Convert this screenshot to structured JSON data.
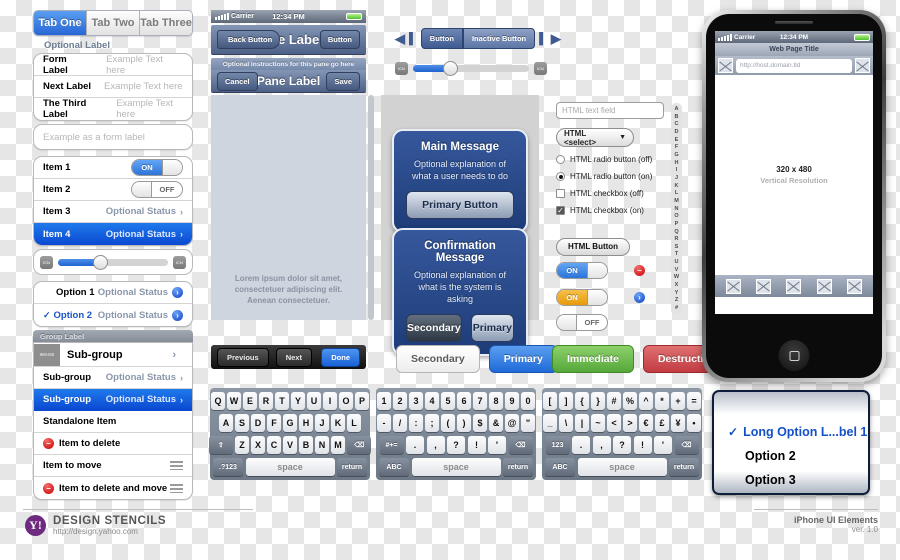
{
  "tabs": [
    {
      "label": "Tab One",
      "active": true
    },
    {
      "label": "Tab Two",
      "active": false
    },
    {
      "label": "Tab Three",
      "active": false
    }
  ],
  "form": {
    "optional_label": "Optional Label",
    "rows": [
      {
        "label": "Form Label",
        "placeholder": "Example Text here"
      },
      {
        "label": "Next Label",
        "placeholder": "Example Text here"
      },
      {
        "label": "The Third Label",
        "placeholder": "Example Text here"
      }
    ],
    "standalone_placeholder": "Example as a form label"
  },
  "items": [
    {
      "label": "Item 1",
      "toggle": "ON"
    },
    {
      "label": "Item 2",
      "toggle": "OFF"
    },
    {
      "label": "Item 3",
      "status": "Optional Status"
    },
    {
      "label": "Item 4",
      "status": "Optional Status",
      "selected": true
    }
  ],
  "options": [
    {
      "label": "Option 1",
      "status": "Optional Status",
      "checked": false
    },
    {
      "label": "Option 2",
      "status": "Optional Status",
      "checked": true
    }
  ],
  "group": {
    "label": "Group Label",
    "image_tag": "IMAGE",
    "rows": [
      {
        "label": "Sub-group",
        "status": "",
        "image": true
      },
      {
        "label": "Sub-group",
        "status": "Optional Status"
      },
      {
        "label": "Sub-group",
        "status": "Optional Status",
        "selected": true
      },
      {
        "label": "Standalone Item"
      },
      {
        "label": "Item to delete",
        "delete": true
      },
      {
        "label": "Item to move",
        "move": true
      },
      {
        "label": "Item to delete and move",
        "delete": true,
        "move": true
      }
    ]
  },
  "status_bar": {
    "carrier": "Carrier",
    "time": "12:34 PM"
  },
  "navbar1": {
    "back": "Back Button",
    "title": "Pane Label",
    "right": "Button"
  },
  "navbar2": {
    "instructions": "Optional instructions for this pane go here",
    "cancel": "Cancel",
    "title": "Pane Label",
    "save": "Save"
  },
  "pane": {
    "lorem": "Lorem ipsum dolor sit amet, consectetuer adipiscing elit. Aenean consectetuer."
  },
  "toolbar": {
    "previous": "Previous",
    "next": "Next",
    "done": "Done"
  },
  "segmented": {
    "button": "Button",
    "inactive": "Inactive Button"
  },
  "alerts": [
    {
      "title": "Main Message",
      "body": "Optional explanation of what a user needs to do",
      "buttons": [
        {
          "label": "Primary Button",
          "style": "primary"
        }
      ]
    },
    {
      "title": "Confirmation Message",
      "body": "Optional explanation of what is the system is asking",
      "buttons": [
        {
          "label": "Secondary",
          "style": "secondary"
        },
        {
          "label": "Primary",
          "style": "primary"
        }
      ]
    }
  ],
  "html_controls": {
    "text_field_placeholder": "HTML text field",
    "select_label": "HTML <select>",
    "radio_off": "HTML radio button (off)",
    "radio_on": "HTML radio button (on)",
    "checkbox_off": "HTML checkbox (off)",
    "checkbox_on": "HTML checkbox (on)",
    "button": "HTML Button",
    "toggle_blue": "ON",
    "toggle_amber": "ON",
    "toggle_off": "OFF"
  },
  "index_bar": [
    "A",
    "B",
    "C",
    "D",
    "E",
    "F",
    "G",
    "H",
    "I",
    "J",
    "K",
    "L",
    "M",
    "N",
    "O",
    "P",
    "Q",
    "R",
    "S",
    "T",
    "U",
    "V",
    "W",
    "X",
    "Y",
    "Z",
    "#"
  ],
  "buttons": [
    {
      "label": "Secondary",
      "style": "secondary"
    },
    {
      "label": "Primary",
      "style": "primary"
    },
    {
      "label": "Immediate",
      "style": "green"
    },
    {
      "label": "Destructive",
      "style": "red"
    }
  ],
  "keyboards": {
    "alpha": {
      "row1": [
        "Q",
        "W",
        "E",
        "R",
        "T",
        "Y",
        "U",
        "I",
        "O",
        "P"
      ],
      "row2": [
        "A",
        "S",
        "D",
        "F",
        "G",
        "H",
        "J",
        "K",
        "L"
      ],
      "row3": [
        "Z",
        "X",
        "C",
        "V",
        "B",
        "N",
        "M"
      ],
      "shift": "⇧",
      "backspace": "⌫",
      "mode": ".?123",
      "space": "space",
      "return": "return"
    },
    "numeric": {
      "row1": [
        "1",
        "2",
        "3",
        "4",
        "5",
        "6",
        "7",
        "8",
        "9",
        "0"
      ],
      "row2": [
        "-",
        "/",
        ":",
        ";",
        "(",
        ")",
        "$",
        "&",
        "@",
        "\""
      ],
      "row3": [
        ".",
        ",",
        "?",
        "!",
        "'"
      ],
      "alt": "#+=",
      "backspace": "⌫",
      "mode": "ABC",
      "space": "space",
      "return": "return"
    },
    "symbol": {
      "row1": [
        "[",
        "]",
        "{",
        "}",
        "#",
        "%",
        "^",
        "*",
        "+",
        "="
      ],
      "row2": [
        "_",
        "\\",
        "|",
        "~",
        "<",
        ">",
        "€",
        "£",
        "¥",
        "•"
      ],
      "row3": [
        ".",
        ",",
        "?",
        "!",
        "'"
      ],
      "alt": "123",
      "backspace": "⌫",
      "mode": "ABC",
      "space": "space",
      "return": "return"
    }
  },
  "picker": {
    "rows": [
      {
        "label": "Long Option L...bel 1",
        "selected": true
      },
      {
        "label": "Option 2",
        "selected": false
      },
      {
        "label": "Option 3",
        "selected": false
      }
    ],
    "check": "✓"
  },
  "phone": {
    "carrier": "Carrier",
    "time": "12:34 PM",
    "page_title": "Web Page Title",
    "url": "http://host.domain.tld",
    "resolution": "320 x 480",
    "resolution_sub": "Vertical Resolution"
  },
  "footer": {
    "brand": "DESIGN STENCILS",
    "url": "http://design.yahoo.com",
    "logo": "Y!",
    "title": "iPhone UI Elements",
    "version": "ver. 1.0"
  }
}
